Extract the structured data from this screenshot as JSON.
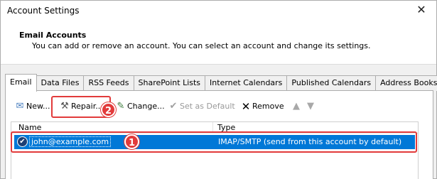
{
  "window": {
    "title": "Account Settings",
    "close_glyph": "✕"
  },
  "header": {
    "title": "Email Accounts",
    "description": "You can add or remove an account. You can select an account and change its settings."
  },
  "tabs": [
    {
      "label": "Email",
      "active": true
    },
    {
      "label": "Data Files"
    },
    {
      "label": "RSS Feeds"
    },
    {
      "label": "SharePoint Lists"
    },
    {
      "label": "Internet Calendars"
    },
    {
      "label": "Published Calendars"
    },
    {
      "label": "Address Books"
    }
  ],
  "toolbar": {
    "new_label": "New...",
    "repair_label": "Repair...",
    "change_label": "Change...",
    "set_default_label": "Set as Default",
    "remove_label": "Remove",
    "icons": {
      "new": "new-account-icon",
      "repair": "repair-tools-icon",
      "change": "change-icon",
      "set_default": "checkmark-icon",
      "remove": "remove-x-icon",
      "up": "move-up-icon",
      "down": "move-down-icon"
    }
  },
  "list": {
    "headers": {
      "name": "Name",
      "type": "Type"
    },
    "rows": [
      {
        "name": "john@example.com",
        "type": "IMAP/SMTP (send from this account by default)",
        "selected": true,
        "default": true
      }
    ]
  },
  "annotations": {
    "badge_1": "1",
    "badge_2": "2",
    "highlight_color": "#e23b3b"
  },
  "colors": {
    "selection": "#0078d7",
    "window_bg": "#f0f0f0"
  }
}
